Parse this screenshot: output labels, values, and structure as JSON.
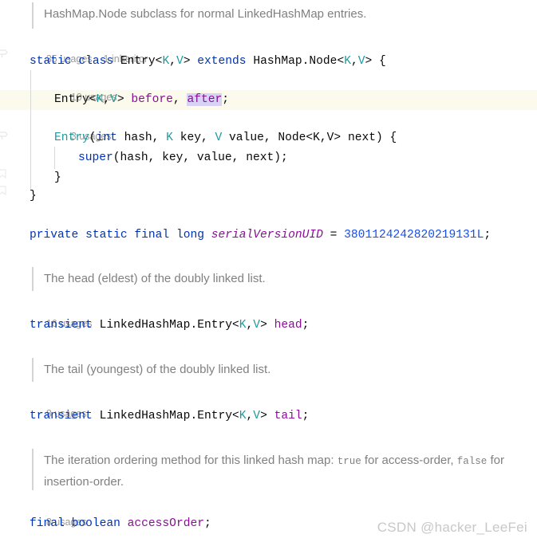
{
  "editor": {
    "language": "java",
    "colors": {
      "background": "#ffffff",
      "keyword": "#0033b3",
      "type": "#20999d",
      "field": "#871094",
      "number": "#1750eb",
      "identifier": "#080808",
      "doc_comment": "#808080",
      "hint": "#9a9a9a",
      "current_line": "#fcf9ed",
      "selection": "#d8d3f5",
      "indent_guide": "#d8d8d8",
      "watermark": "#c8c8c8"
    }
  },
  "doc_blocks": {
    "entry_class": "HashMap.Node subclass for normal LinkedHashMap entries.",
    "head_field": "The head (eldest) of the doubly linked list.",
    "tail_field": "The tail (youngest) of the doubly linked list.",
    "access_order_prefix": "The iteration ordering method for this linked hash map: ",
    "access_order_true": "true",
    "access_order_mid": " for access-order, ",
    "access_order_false": "false",
    "access_order_suffix": " for insertion-order."
  },
  "hints": {
    "entry_class_usages": "35 usages",
    "entry_class_inheritors": "1 inheritor",
    "before_after_usages": "10 usages",
    "constructor_usages": "3 usages",
    "head_usages": "16 usages",
    "tail_usages": "8 usages",
    "access_order_usages": "8 usages"
  },
  "code": {
    "class_decl": {
      "kw_static": "static",
      "kw_class": "class",
      "name": "Entry",
      "generic_open": "<",
      "gen_k": "K",
      "comma": ",",
      "gen_v": "V",
      "generic_close": ">",
      "kw_extends": "extends",
      "super_type": "HashMap.Node",
      "brace": "{"
    },
    "fields_line": {
      "type": "Entry",
      "generic": "<K,V>",
      "field_before": "before",
      "separator": ", ",
      "field_after": "after",
      "semicolon": ";"
    },
    "constructor": {
      "name": "Entry",
      "paren_open": "(",
      "kw_int": "int",
      "param_hash": "hash",
      "type_k": "K",
      "param_key": "key",
      "type_v": "V",
      "param_value": "value",
      "type_node": "Node<K,V>",
      "param_next": "next",
      "paren_close": ")",
      "brace": "{"
    },
    "super_call": {
      "kw_super": "super",
      "args": "(hash, key, value, next);"
    },
    "close_inner": "}",
    "close_outer": "}",
    "serial_version": {
      "kw_private": "private",
      "kw_static": "static",
      "kw_final": "final",
      "kw_long": "long",
      "name": "serialVersionUID",
      "equals": "=",
      "value": "3801124242820219131L",
      "semicolon": ";"
    },
    "head_decl": {
      "kw_transient": "transient",
      "type": "LinkedHashMap.Entry",
      "generic_open": "<",
      "gen_k": "K",
      "comma": ",",
      "gen_v": "V",
      "generic_close": ">",
      "field": "head",
      "semicolon": ";"
    },
    "tail_decl": {
      "kw_transient": "transient",
      "type": "LinkedHashMap.Entry",
      "generic_open": "<",
      "gen_k": "K",
      "comma": ",",
      "gen_v": "V",
      "generic_close": ">",
      "field": "tail",
      "semicolon": ";"
    },
    "access_order_decl": {
      "kw_final": "final",
      "kw_boolean": "boolean",
      "field": "accessOrder",
      "semicolon": ";"
    }
  },
  "watermark": {
    "text": "CSDN @hacker_LeeFei"
  }
}
